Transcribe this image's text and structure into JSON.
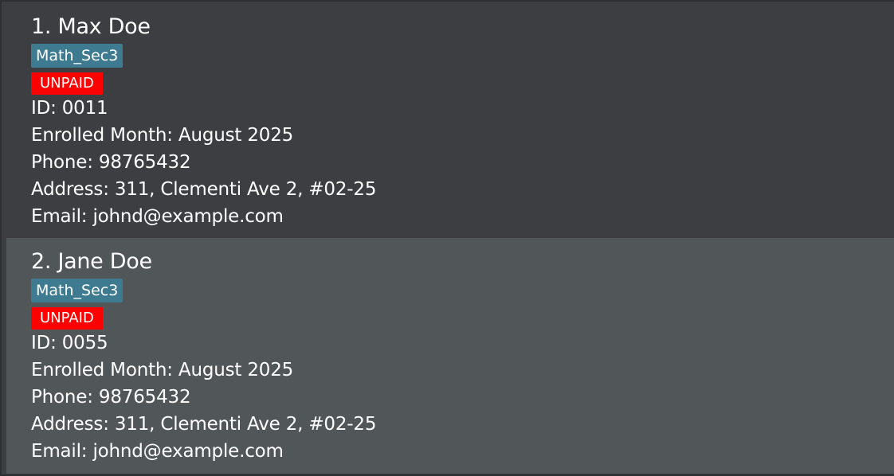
{
  "persons": [
    {
      "name": "1. Max Doe",
      "tag": "Math_Sec3",
      "payment_status": "UNPAID",
      "id": "ID: 0011",
      "enrolled_month": "Enrolled Month: August 2025",
      "phone": "Phone: 98765432",
      "address": "Address: 311, Clementi Ave 2, #02-25",
      "email": "Email: johnd@example.com"
    },
    {
      "name": "2. Jane Doe",
      "tag": "Math_Sec3",
      "payment_status": "UNPAID",
      "id": "ID: 0055",
      "enrolled_month": "Enrolled Month: August 2025",
      "phone": "Phone: 98765432",
      "address": "Address: 311, Clementi Ave 2, #02-25",
      "email": "Email: johnd@example.com"
    }
  ],
  "colors": {
    "card_odd_bg": "#3c3e41",
    "card_even_bg": "#515658",
    "tag_bg": "#3e7b91",
    "unpaid_badge_bg": "#ff0000",
    "text": "#ffffff"
  }
}
